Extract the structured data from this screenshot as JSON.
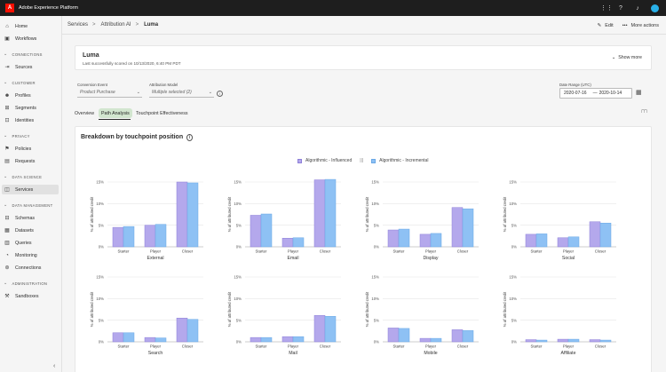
{
  "topbar": {
    "logo_letter": "A",
    "app_title": "Adobe Experience Platform"
  },
  "sidebar": {
    "items": [
      {
        "label": "Home",
        "icon": "home-icon",
        "glyph": "⌂"
      },
      {
        "label": "Workflows",
        "icon": "workflows-icon",
        "glyph": "▣"
      },
      {
        "label": "Sources",
        "icon": "sources-icon",
        "glyph": "⇥"
      },
      {
        "label": "Profiles",
        "icon": "profiles-icon",
        "glyph": "☻"
      },
      {
        "label": "Segments",
        "icon": "segments-icon",
        "glyph": "⊞"
      },
      {
        "label": "Identities",
        "icon": "identities-icon",
        "glyph": "⊡"
      },
      {
        "label": "Policies",
        "icon": "policies-icon",
        "glyph": "⚑"
      },
      {
        "label": "Requests",
        "icon": "requests-icon",
        "glyph": "▤"
      },
      {
        "label": "Services",
        "icon": "services-icon",
        "glyph": "◫"
      },
      {
        "label": "Schemas",
        "icon": "schemas-icon",
        "glyph": "⊟"
      },
      {
        "label": "Datasets",
        "icon": "datasets-icon",
        "glyph": "▦"
      },
      {
        "label": "Queries",
        "icon": "queries-icon",
        "glyph": "▥"
      },
      {
        "label": "Monitoring",
        "icon": "monitoring-icon",
        "glyph": "◔"
      },
      {
        "label": "Connections",
        "icon": "connections-icon",
        "glyph": "⊛"
      },
      {
        "label": "Sandboxes",
        "icon": "sandboxes-icon",
        "glyph": "⚒"
      }
    ],
    "sections": [
      "CONNECTIONS",
      "CUSTOMER",
      "PRIVACY",
      "DATA SCIENCE",
      "DATA MANAGEMENT",
      "ADMINISTRATION"
    ],
    "active_item": "Services"
  },
  "breadcrumb": {
    "items": [
      "Services",
      "Attribution AI",
      "Luma"
    ],
    "separator": ">"
  },
  "header_actions": {
    "edit": "Edit",
    "more": "More actions"
  },
  "model": {
    "name": "Luma",
    "scored": "Last successfully scored on 10/13/2020, 6:40 PM PDT",
    "show_more": "Show more"
  },
  "filters": {
    "conversion_label": "Conversion Event",
    "conversion_value": "Product Purchase",
    "attribution_label": "Attribution Model",
    "attribution_value": "Multiple selected (2)",
    "date_label": "Date Range (UTC)",
    "date_start": "2020-07-16",
    "date_sep": "—",
    "date_end": "2020-10-14"
  },
  "tabs": [
    "Overview",
    "Path Analysis",
    "Touchpoint Effectiveness"
  ],
  "active_tab": "Path Analysis",
  "section_title": "Breakdown by touchpoint position",
  "colors": {
    "influenced": "#b4a8ec",
    "incremental": "#8ec1f4",
    "active_tab_bg": "#d2e6cf"
  },
  "chart_data": {
    "type": "bar",
    "legend": [
      {
        "name": "Algorithmic - Influenced",
        "color": "#b4a8ec"
      },
      {
        "name": "Algorithmic - Incremental",
        "color": "#8ec1f4"
      }
    ],
    "legend_separator": "|||",
    "ylabel": "% of attributed credit",
    "yticks": [
      "15%",
      "10%",
      "5%",
      "0%"
    ],
    "ylim": [
      0,
      15
    ],
    "categories": [
      "Starter",
      "Player",
      "Closer"
    ],
    "charts": [
      {
        "title": "External",
        "influenced": [
          4.5,
          5.0,
          15.0
        ],
        "incremental": [
          4.7,
          5.2,
          14.8
        ]
      },
      {
        "title": "Email",
        "influenced": [
          7.3,
          2.0,
          15.5
        ],
        "incremental": [
          7.6,
          2.1,
          15.6
        ]
      },
      {
        "title": "Display",
        "influenced": [
          3.9,
          2.9,
          9.1
        ],
        "incremental": [
          4.1,
          3.1,
          8.8
        ]
      },
      {
        "title": "Social",
        "influenced": [
          2.9,
          2.1,
          5.8
        ],
        "incremental": [
          3.0,
          2.3,
          5.5
        ]
      },
      {
        "title": "Search",
        "influenced": [
          2.1,
          1.0,
          5.5
        ],
        "incremental": [
          2.1,
          0.9,
          5.2
        ]
      },
      {
        "title": "Mail",
        "influenced": [
          1.0,
          1.2,
          6.1
        ],
        "incremental": [
          1.0,
          1.2,
          5.9
        ]
      },
      {
        "title": "Mobile",
        "influenced": [
          3.2,
          0.8,
          2.8
        ],
        "incremental": [
          3.1,
          0.8,
          2.6
        ]
      },
      {
        "title": "Affiliate",
        "influenced": [
          0.5,
          0.6,
          0.5
        ],
        "incremental": [
          0.4,
          0.6,
          0.4
        ]
      }
    ]
  }
}
